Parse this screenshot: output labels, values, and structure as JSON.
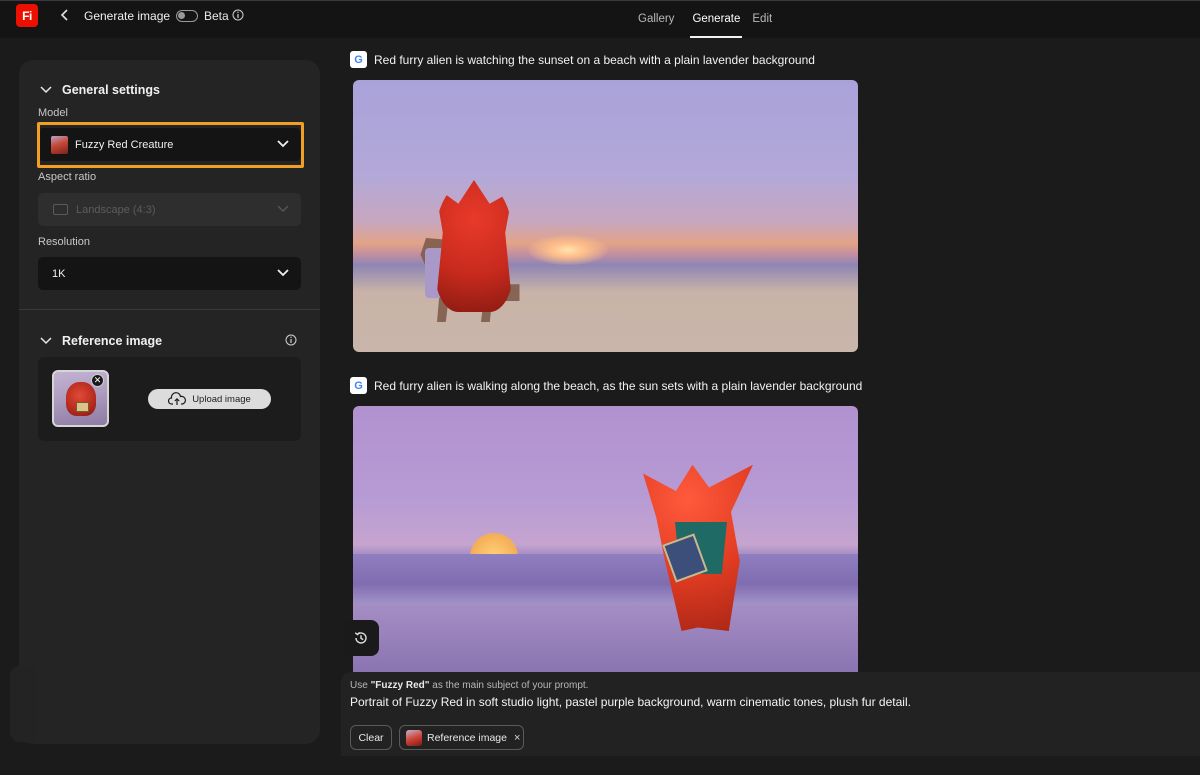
{
  "header": {
    "logo_text": "Fi",
    "title": "Generate image",
    "beta_label": "Beta",
    "tabs": [
      {
        "label": "Gallery",
        "active": false
      },
      {
        "label": "Generate",
        "active": true
      },
      {
        "label": "Edit",
        "active": false
      }
    ]
  },
  "sidebar": {
    "general_settings_title": "General settings",
    "model_label": "Model",
    "model_value": "Fuzzy Red Creature",
    "aspect_ratio_label": "Aspect ratio",
    "aspect_ratio_value": "Landscape (4:3)",
    "resolution_label": "Resolution",
    "resolution_value": "1K",
    "reference_title": "Reference image",
    "upload_label": "Upload image"
  },
  "results": [
    {
      "prompt": "Red furry alien is watching the sunset on a beach with a plain lavender background"
    },
    {
      "prompt": "Red furry alien is walking along the beach, as the sun sets with a plain lavender background"
    }
  ],
  "prompt_bar": {
    "hint_prefix": "Use ",
    "hint_subject": "\"Fuzzy Red\"",
    "hint_suffix": " as the main subject of your prompt.",
    "text": "Portrait of Fuzzy Red in soft studio light, pastel purple background, warm cinematic tones, plush fur detail.",
    "clear_label": "Clear",
    "reference_chip_label": "Reference image"
  },
  "colors": {
    "accent_highlight": "#f2a024",
    "brand": "#eb1000",
    "background": "#1b1b1b"
  }
}
